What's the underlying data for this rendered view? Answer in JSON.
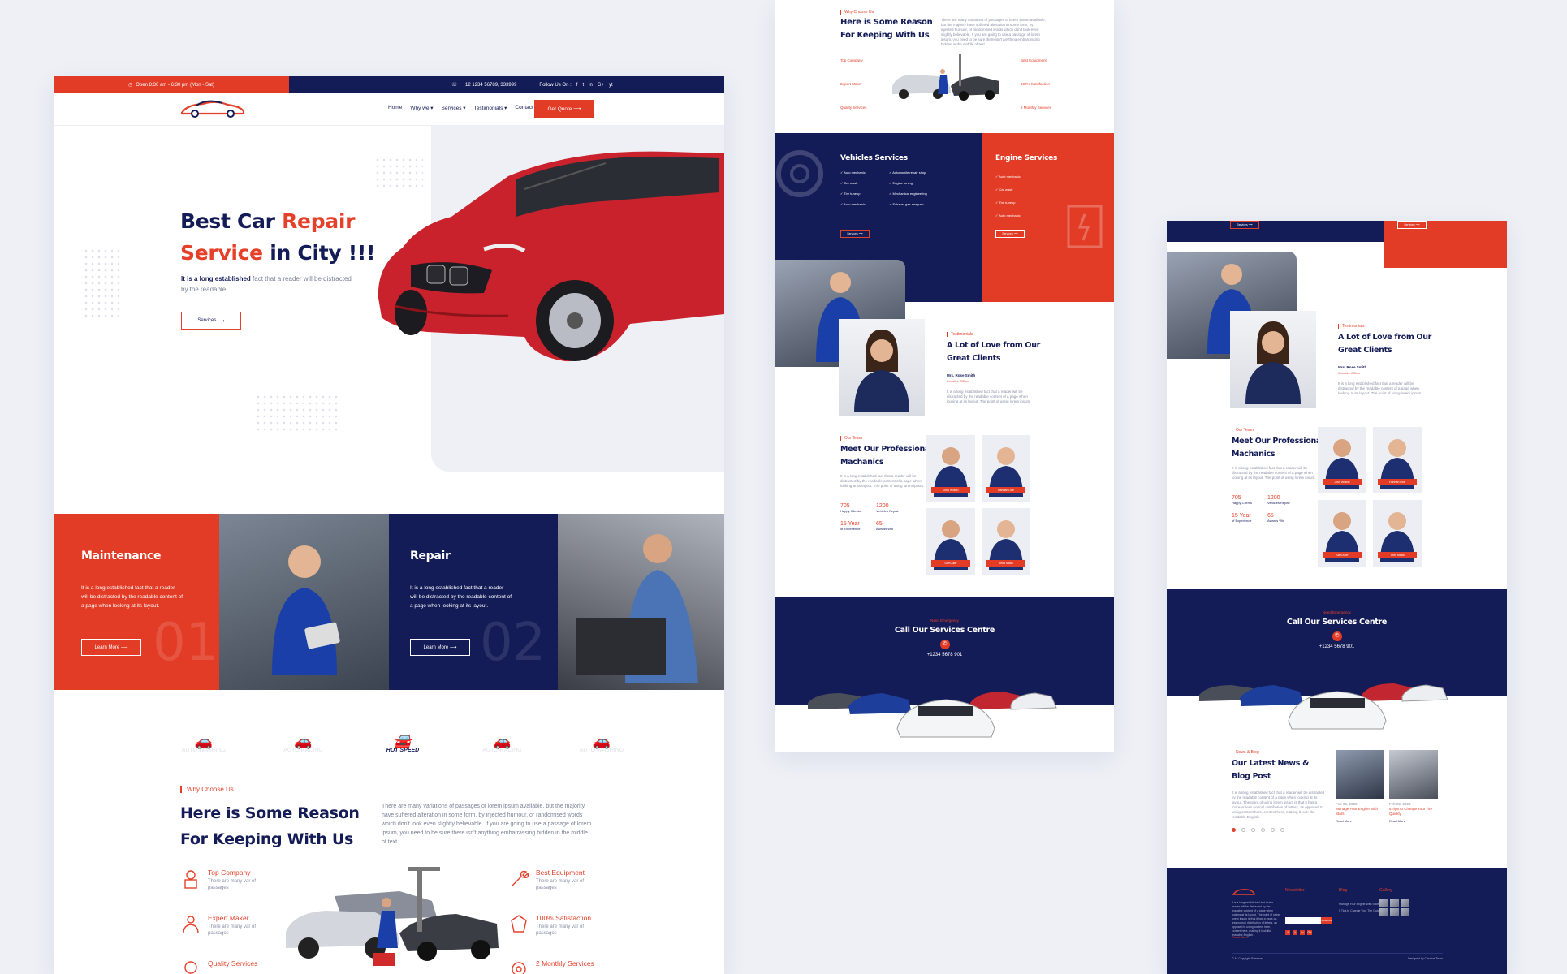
{
  "colors": {
    "navy": "#141c57",
    "red": "#e23c26",
    "bg": "#eef0f6"
  },
  "topbar": {
    "hours": "Open 8:30 am - 6:30 pm (Mon - Sat)",
    "phone": "+12 1234 56789, 333999",
    "follow": "Follow Us On :",
    "social_icons": [
      "f",
      "t",
      "in",
      "G+",
      "yt"
    ]
  },
  "nav": {
    "items": [
      "Home",
      "Why we",
      "Services",
      "Testimonials",
      "Contact"
    ],
    "cta": "Get Quote"
  },
  "hero": {
    "title_a": "Best Car ",
    "title_b": "Repair",
    "title_c": "Service",
    "title_d": " in City !!!",
    "desc_bold": "It is a long established",
    "desc_rest": " fact that a reader will be distracted by the readable.",
    "button": "Services"
  },
  "services": [
    {
      "title": "Maintenance",
      "desc": "It is a long established fact that a reader will be distracted by the readable content of a page when looking at its layout.",
      "button": "Learn More",
      "num": "01"
    },
    {
      "title": "Repair",
      "desc": "It is a long established fact that a reader will be distracted by the readable content of a page when looking at its layout.",
      "button": "Learn More",
      "num": "02"
    }
  ],
  "logos": [
    "AUTO WASHING",
    "AUTO RACING",
    "HOT SPEED",
    "AUTO RACING",
    "AUTO WASHING"
  ],
  "why": {
    "eyebrow": "Why Choose Us",
    "title1": "Here is Some Reason",
    "title2": "For Keeping With Us",
    "desc": "There are many variations of passages of lorem ipsum available, but the majority have suffered alteration in some form, by injected humour, or randomised words which don't look even slightly believable. If you are going to use a passage of lorem ipsum, you need to be sure there isn't anything embarrassing hidden in the middle of text.",
    "features_left": [
      {
        "title": "Top Company",
        "desc": "There are many var of passages"
      },
      {
        "title": "Expert Maker",
        "desc": "There are many var of passages"
      },
      {
        "title": "Quality Services",
        "desc": "There are many var of passages"
      }
    ],
    "features_right": [
      {
        "title": "Best Equipment",
        "desc": "There are many var of passages"
      },
      {
        "title": "100% Satisfaction",
        "desc": "There are many var of passages"
      },
      {
        "title": "2 Monthly Services",
        "desc": "There are many var of passages"
      }
    ]
  },
  "vehicle_services": {
    "title": "Vehicles Services",
    "items": [
      "Auto mechanic",
      "Automobile repair shop",
      "Car wash",
      "Engine tuning",
      "Tire tuneup",
      "Mechanical engineering",
      "Auto mechanic",
      "Exhaust gas analyzer"
    ],
    "button": "Services"
  },
  "engine_services": {
    "title": "Engine Services",
    "items": [
      "Auto mechanic",
      "Car wash",
      "Tire tuneup",
      "Auto mechanic"
    ],
    "button": "Services"
  },
  "testimonial": {
    "eyebrow": "Testimonials",
    "title1": "A Lot of Love from Our",
    "title2": "Great Clients",
    "name": "Mrs. Rose Smith",
    "role": "Creative Officer",
    "quote": "It is a long established fact that a reader will be distracted by the readable content of a page when looking at its layout. The point of using lorem ipsum."
  },
  "team": {
    "eyebrow": "Our Team",
    "title1": "Meet Our Professional",
    "title2": "Machanics",
    "desc": "It is a long established fact that a reader will be distracted by the readable content of a page when looking at its layout. The point of using lorem ipsum.",
    "stats": [
      {
        "value": "705",
        "label": "Happy Clients"
      },
      {
        "value": "1200",
        "label": "Vehicles Repair"
      },
      {
        "value": "15 Year",
        "label": "of Experience"
      },
      {
        "value": "65",
        "label": "Awards Win"
      }
    ],
    "members": [
      "Josh Wilson",
      "Hannah Doe",
      "Sam Alter",
      "Tedo Malta"
    ]
  },
  "emergency": {
    "eyebrow": "Need Emergency",
    "title": "Call Our Services Centre",
    "phone": "+1234 5678 901"
  },
  "news": {
    "eyebrow": "News & Blog",
    "title1": "Our Latest News &",
    "title2": "Blog Post",
    "desc": "It is a long established fact that a reader will be distracted by the readable content of a page when looking at its layout. The point of using lorem ipsum is that it has a more-or-less normal distribution of letters, as opposed to using content here, content here, making it look like readable English.",
    "posts": [
      {
        "title": "Manage Your Engine With Stars",
        "date": "Feb 05, 2022",
        "more": "Read More"
      },
      {
        "title": "5 Tips to Change Your Tire Quickly",
        "date": "Feb 05, 2022",
        "more": "Read More"
      }
    ]
  },
  "footer": {
    "newsletter": "Newsletter",
    "blog": "Blog",
    "gallery": "Gallery",
    "subscribe": "Subscribe",
    "read_more": "Read More",
    "copyright": "© All Copyright Reserved",
    "designed": "Designed by Creative Team"
  }
}
